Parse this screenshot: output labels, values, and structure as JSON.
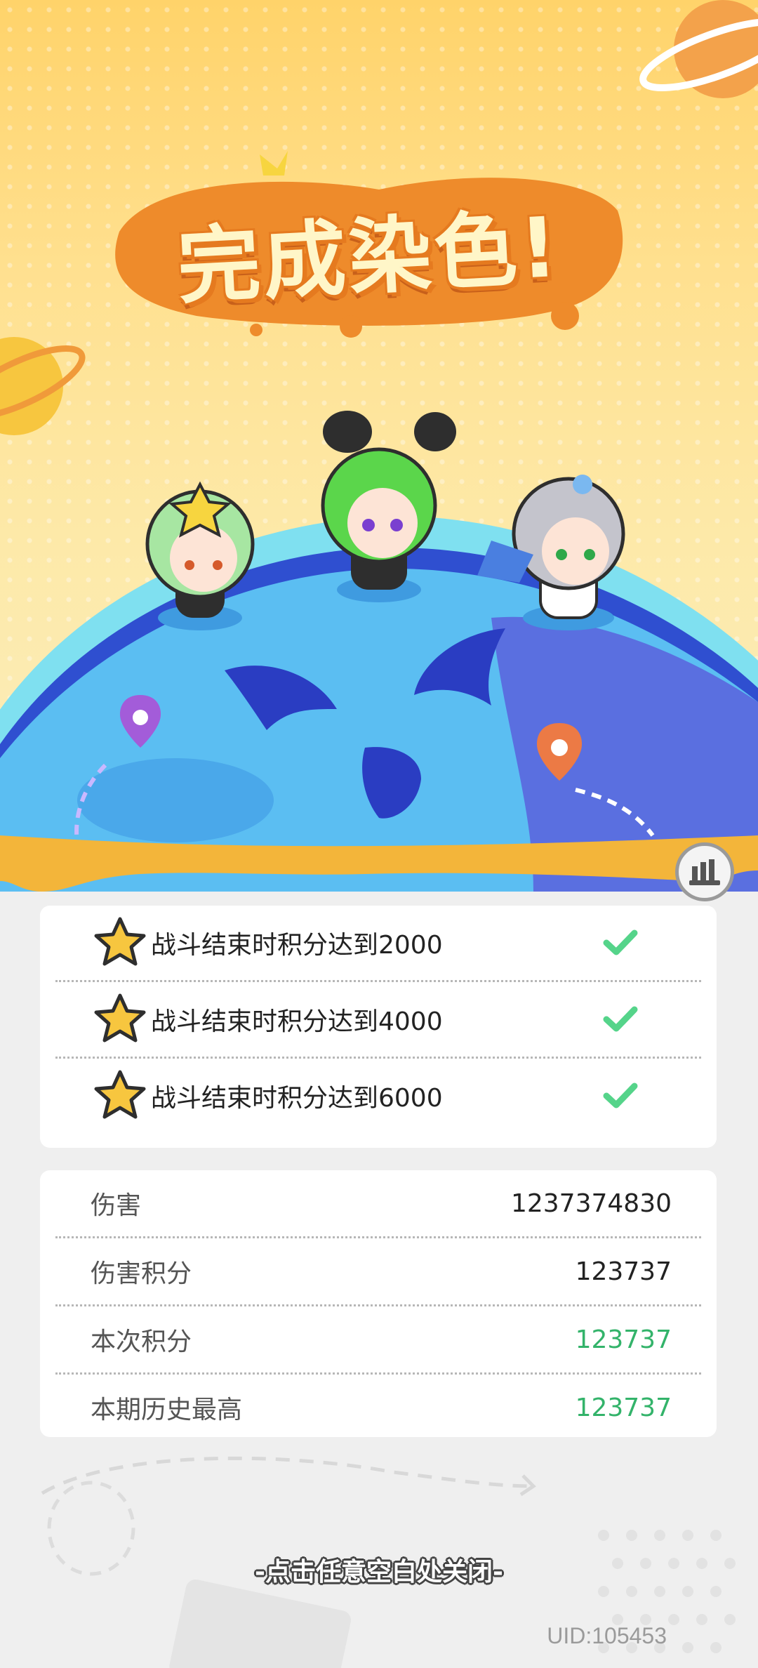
{
  "banner": {
    "title": "完成染色!"
  },
  "colors": {
    "accent_orange": "#e57a1f",
    "check_green": "#55d48a",
    "highlight_value": "#33b36a"
  },
  "goals": [
    {
      "label": "战斗结束时积分达到2000",
      "icon": "star-icon",
      "completed": true
    },
    {
      "label": "战斗结束时积分达到4000",
      "icon": "star-icon",
      "completed": true
    },
    {
      "label": "战斗结束时积分达到6000",
      "icon": "star-icon",
      "completed": true
    }
  ],
  "stats": [
    {
      "label": "伤害",
      "value": "1237374830"
    },
    {
      "label": "伤害积分",
      "value": "123737"
    },
    {
      "label": "本次积分",
      "value": "123737"
    },
    {
      "label": "本期历史最高",
      "value": "123737"
    }
  ],
  "footer": {
    "close_hint": "-点击任意空白处关闭-",
    "uid": "UID:105453"
  },
  "icons": {
    "stats_button": "bar-chart-icon",
    "check": "check-icon",
    "map_pin": "location-pin-icon"
  }
}
